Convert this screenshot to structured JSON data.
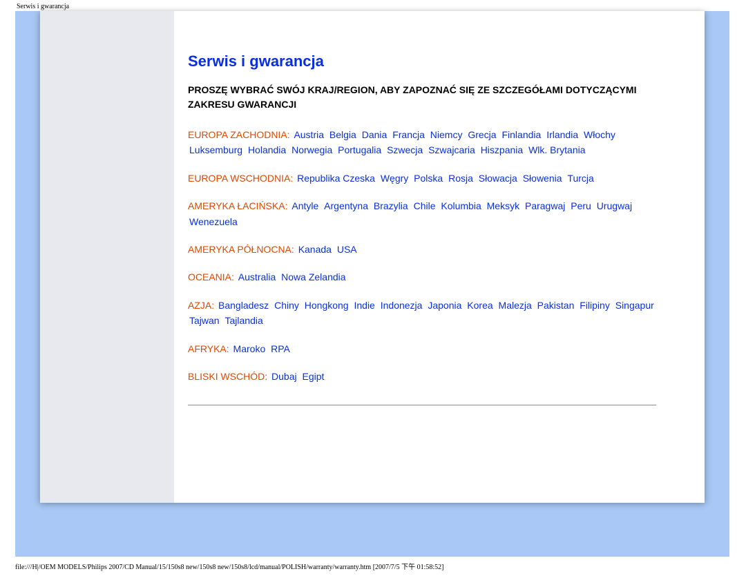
{
  "page_header": "Serwis i gwarancja",
  "title": "Serwis i gwarancja",
  "intro": "PROSZĘ WYBRAĆ SWÓJ KRAJ/REGION, ABY ZAPOZNAĆ SIĘ ZE SZCZEGÓŁAMI DOTYCZĄCYMI ZAKRESU GWARANCJI",
  "regions": [
    {
      "name": "EUROPA ZACHODNIA:",
      "countries": [
        "Austria",
        "Belgia",
        "Dania",
        "Francja",
        "Niemcy",
        "Grecja",
        "Finlandia",
        "Irlandia",
        "Włochy",
        "Luksemburg",
        "Holandia",
        "Norwegia",
        "Portugalia",
        "Szwecja",
        "Szwajcaria",
        "Hiszpania",
        "Wlk. Brytania"
      ]
    },
    {
      "name": "EUROPA WSCHODNIA:",
      "countries": [
        "Republika Czeska",
        "Węgry",
        "Polska",
        "Rosja",
        "Słowacja",
        "Słowenia",
        "Turcja"
      ]
    },
    {
      "name": "AMERYKA ŁACIŃSKA:",
      "countries": [
        "Antyle",
        "Argentyna",
        "Brazylia",
        "Chile",
        "Kolumbia",
        "Meksyk",
        "Paragwaj",
        "Peru",
        "Urugwaj",
        "Wenezuela"
      ]
    },
    {
      "name": "AMERYKA PÓŁNOCNA:",
      "countries": [
        "Kanada",
        "USA"
      ]
    },
    {
      "name": "OCEANIA:",
      "countries": [
        "Australia",
        "Nowa Zelandia"
      ]
    },
    {
      "name": "AZJA:",
      "countries": [
        "Bangladesz",
        "Chiny",
        "Hongkong",
        "Indie",
        "Indonezja",
        "Japonia",
        "Korea",
        "Malezja",
        "Pakistan",
        "Filipiny",
        "Singapur",
        "Tajwan",
        "Tajlandia"
      ]
    },
    {
      "name": "AFRYKA:",
      "countries": [
        "Maroko",
        "RPA"
      ]
    },
    {
      "name": "BLISKI WSCHÓD:",
      "countries": [
        "Dubaj",
        "Egipt"
      ]
    }
  ],
  "footer": "file:///H|/OEM MODELS/Philips 2007/CD Manual/15/150s8 new/150s8 new/150s8/lcd/manual/POLISH/warranty/warranty.htm [2007/7/5 下午 01:58:52]"
}
